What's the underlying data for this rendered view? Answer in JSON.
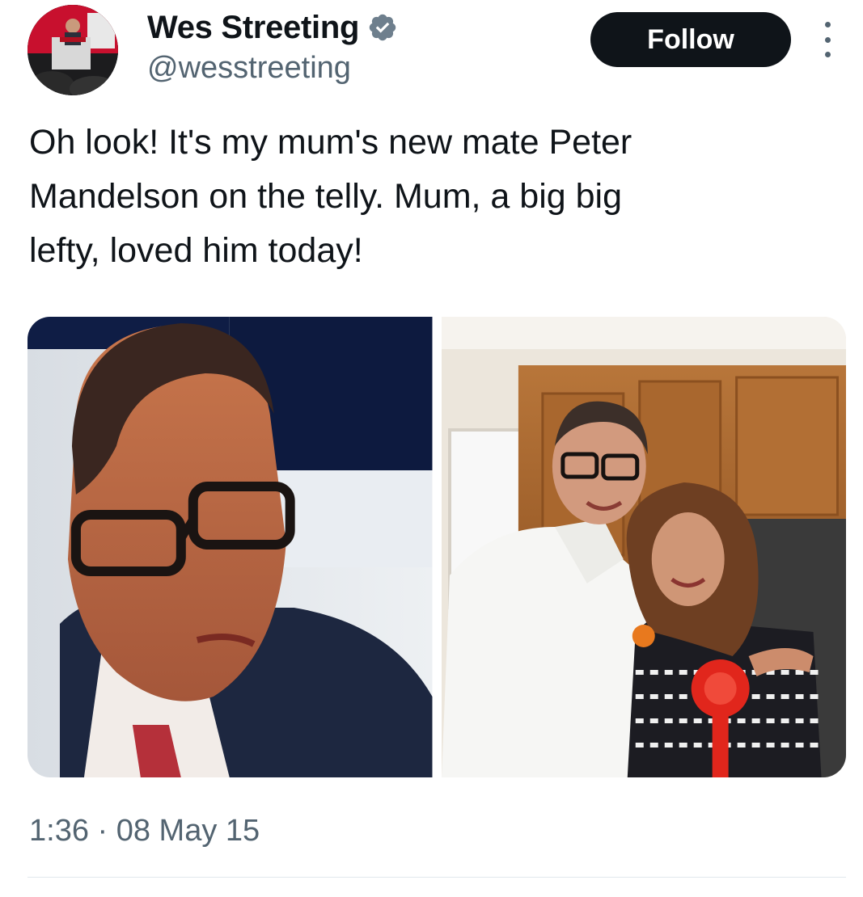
{
  "author": {
    "display_name": "Wes Streeting",
    "handle": "@wesstreeting",
    "verified": true,
    "avatar_icon": "profile-photo-speaker-at-podium"
  },
  "actions": {
    "follow_label": "Follow",
    "more_icon": "more-options-vertical-icon"
  },
  "tweet": {
    "text": "Oh look! It's my mum's new mate Peter\nMandelson on the telly. Mum, a big big\nlefty, loved him today!",
    "timestamp": "1:36 · 08 May 15"
  },
  "media": {
    "count": 2,
    "photos": [
      {
        "subject": "man-with-glasses-on-tv"
      },
      {
        "subject": "man-and-woman-in-kitchen"
      }
    ]
  },
  "colors": {
    "primary_text": "#0f1419",
    "secondary_text": "#536471",
    "verified_badge": "#6e7f8d",
    "follow_button_bg": "#0f1419",
    "follow_button_text": "#ffffff"
  }
}
